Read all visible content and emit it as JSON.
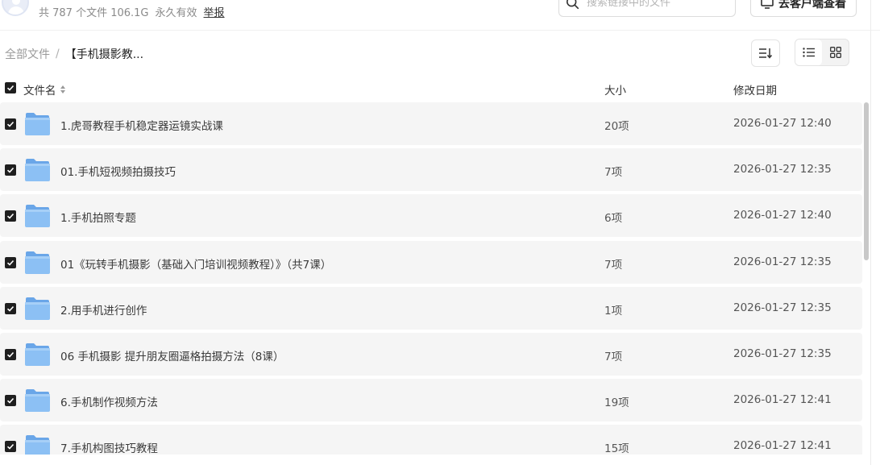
{
  "header": {
    "stats": "共 787 个文件 106.1G",
    "validity": "永久有效",
    "report_label": "举报",
    "search_placeholder": "搜索链接中的文件",
    "client_button_label": "去客户端查看"
  },
  "breadcrumb": {
    "root": "全部文件",
    "separator": "/",
    "current": "【手机摄影教..."
  },
  "columns": {
    "name": "文件名",
    "size": "大小",
    "date": "修改日期"
  },
  "files": [
    {
      "name": "1.虎哥教程手机稳定器运镜实战课",
      "size": "20项",
      "date": "2026-01-27 12:40",
      "checked": true
    },
    {
      "name": "01.手机短视频拍摄技巧",
      "size": "7项",
      "date": "2026-01-27 12:35",
      "checked": true
    },
    {
      "name": "1.手机拍照专题",
      "size": "6项",
      "date": "2026-01-27 12:40",
      "checked": true
    },
    {
      "name": "01《玩转手机摄影（基础入门培训视频教程）》（共7课）",
      "size": "7项",
      "date": "2026-01-27 12:35",
      "checked": true
    },
    {
      "name": "2.用手机进行创作",
      "size": "1项",
      "date": "2026-01-27 12:35",
      "checked": true
    },
    {
      "name": "06 手机摄影 提升朋友圈逼格拍摄方法（8课）",
      "size": "7项",
      "date": "2026-01-27 12:35",
      "checked": true
    },
    {
      "name": "6.手机制作视频方法",
      "size": "19项",
      "date": "2026-01-27 12:41",
      "checked": true
    },
    {
      "name": "7.手机构图技巧教程",
      "size": "15项",
      "date": "2026-01-27 12:41",
      "checked": true
    }
  ],
  "colors": {
    "folder": "#7fb6f0",
    "row_bg": "#f5f5f5",
    "checkbox": "#1f1f1f"
  }
}
